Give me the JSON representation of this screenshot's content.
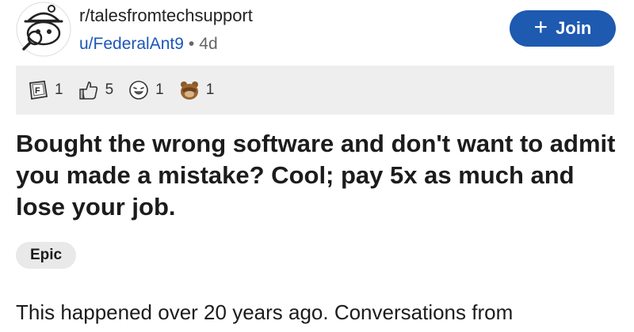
{
  "header": {
    "subreddit": "r/talesfromtechsupport",
    "username": "u/FederalAnt9",
    "separator": "•",
    "age": "4d",
    "join_label": "Join"
  },
  "awards": [
    {
      "icon": "f-keycap-icon",
      "count": "1"
    },
    {
      "icon": "thumbs-up-icon",
      "count": "5"
    },
    {
      "icon": "laughing-face-icon",
      "count": "1"
    },
    {
      "icon": "bear-facepalm-icon",
      "count": "1"
    }
  ],
  "post": {
    "title": "Bought the wrong software and don't want to admit you made a mistake? Cool; pay 5x as much and lose your job.",
    "flair": "Epic",
    "body_excerpt": "This happened over 20 years ago.  Conversations from"
  },
  "colors": {
    "join_button": "#1d5ab0",
    "username": "#1b57b8",
    "award_bar": "#eeeeee",
    "flair_bg": "#e9e9e9"
  }
}
